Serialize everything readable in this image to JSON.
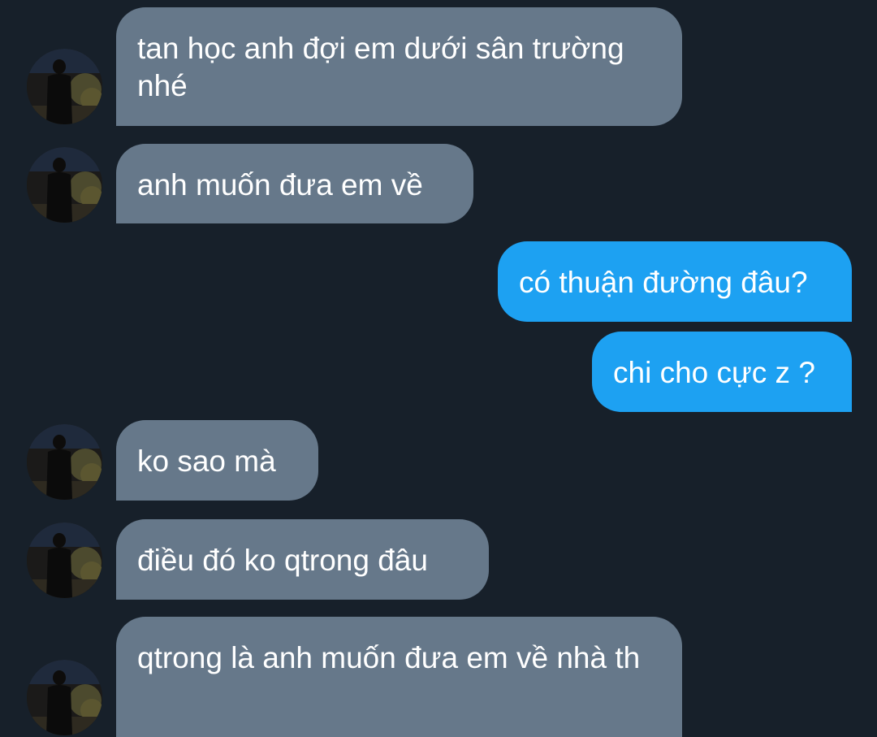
{
  "theme": {
    "background": "#17202a",
    "incoming_bubble": "#66788a",
    "outgoing_bubble": "#1da1f2",
    "text": "#ffffff"
  },
  "messages": [
    {
      "direction": "incoming",
      "text": "tan học anh đợi em dưới sân trường nhé",
      "avatar": "contact-avatar-icon"
    },
    {
      "direction": "incoming",
      "text": "anh muốn đưa em về",
      "avatar": "contact-avatar-icon"
    },
    {
      "direction": "outgoing",
      "text": "có thuận đường đâu?"
    },
    {
      "direction": "outgoing",
      "text": "chi cho cực z ?"
    },
    {
      "direction": "incoming",
      "text": "ko sao mà",
      "avatar": "contact-avatar-icon"
    },
    {
      "direction": "incoming",
      "text": "điều đó ko qtrong đâu",
      "avatar": "contact-avatar-icon"
    },
    {
      "direction": "incoming",
      "text": "qtrong là anh muốn đưa em về nhà th",
      "avatar": "contact-avatar-icon"
    }
  ]
}
